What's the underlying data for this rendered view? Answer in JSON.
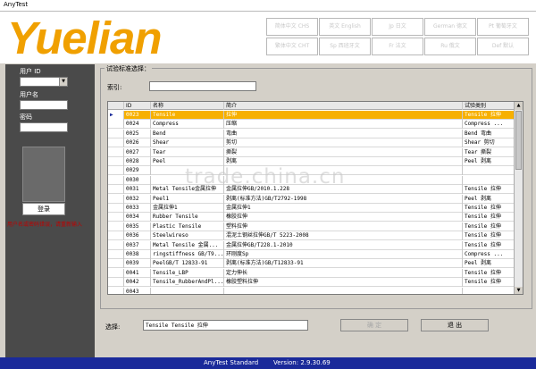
{
  "window": {
    "title": "AnyTest"
  },
  "banner": {
    "logo": "Yuelian",
    "lang_buttons_row1": [
      "简体中文 CHS",
      "英文 English",
      "Jp 日文",
      "German 德文",
      "Pt 葡萄牙文"
    ],
    "lang_buttons_row2": [
      "繁体中文 CHT",
      "Sp 西班牙文",
      "Fr 法文",
      "Ru 俄文",
      "Def 默认"
    ]
  },
  "login": {
    "user_id_label": "用户 ID",
    "user_name_label": "用户名",
    "password_label": "密码",
    "login_button": "登录",
    "error_text": "用户名或密码错误，请重新输入"
  },
  "standard": {
    "group_title": "试验标准选择：",
    "index_label": "索引:"
  },
  "grid": {
    "columns": [
      "ID",
      "名称",
      "简介",
      "试验类别"
    ],
    "rows": [
      [
        "0023",
        "Tensile",
        "拉伸",
        "Tensile 拉伸"
      ],
      [
        "0024",
        "Compress",
        "压缩",
        "Compress ..."
      ],
      [
        "0025",
        "Bend",
        "弯曲",
        "Bend 弯曲"
      ],
      [
        "0026",
        "Shear",
        "剪切",
        "Shear 剪切"
      ],
      [
        "0027",
        "Tear",
        "撕裂",
        "Tear 撕裂"
      ],
      [
        "0028",
        "Peel",
        "剥离",
        "Peel 剥离"
      ],
      [
        "0029",
        "",
        "",
        ""
      ],
      [
        "0030",
        "",
        "",
        ""
      ],
      [
        "0031",
        "Metal Tensile金属拉伸",
        "金属拉伸GB/2010.1.228",
        "Tensile 拉伸"
      ],
      [
        "0032",
        "Peel1",
        "剥离(标准方法)GB/T2792-1998",
        "Peel 剥离"
      ],
      [
        "0033",
        "金属拉伸1",
        "金属拉伸1",
        "Tensile 拉伸"
      ],
      [
        "0034",
        "Rubber Tensile",
        "橡胶拉伸",
        "Tensile 拉伸"
      ],
      [
        "0035",
        "Plastic Tensile",
        "塑料拉伸",
        "Tensile 拉伸"
      ],
      [
        "0036",
        "Steelwireso",
        "混泥土钢丝拉伸GB/T 5223-2008",
        "Tensile 拉伸"
      ],
      [
        "0037",
        "Metal Tensile 金属...",
        "金属拉伸GB/T228.1-2010",
        "Tensile 拉伸"
      ],
      [
        "0038",
        "ringstiffness GB/T9...",
        "环刚度Sp",
        "Compress ..."
      ],
      [
        "0039",
        "PeelGB/T 12833-91",
        "剥离(标准方法)GB/T12833-91",
        "Peel 剥离"
      ],
      [
        "0041",
        "Tensile_LBP",
        "定力伸长",
        "Tensile 拉伸"
      ],
      [
        "0042",
        "Tensile_RubberAndPl...",
        "橡胶塑料拉伸",
        "Tensile 拉伸"
      ],
      [
        "0043",
        "",
        "",
        ""
      ]
    ],
    "selected_index": 0,
    "indicator": "▶"
  },
  "watermark": "trade.china.cn",
  "selection": {
    "label": "选择:",
    "value": "Tensile  Tensile 拉伸",
    "confirm_button": "确 定",
    "exit_button": "退 出"
  },
  "statusbar": {
    "app": "AnyTest Standard",
    "version": "Version: 2.9.30.69"
  },
  "colors": {
    "logo": "#f0a000",
    "selected_row": "#f7b000",
    "statusbar": "#1a2a9a",
    "left_panel": "#4a4a4a",
    "error_text": "#c00000"
  }
}
